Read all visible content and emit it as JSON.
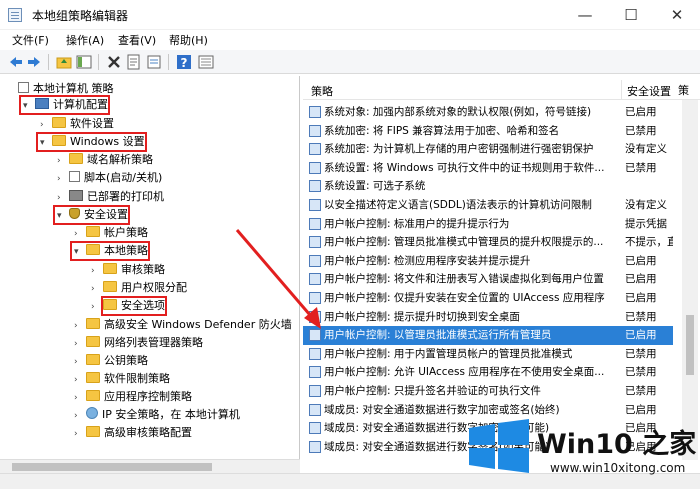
{
  "window": {
    "title": "本地组策略编辑器",
    "min": "—",
    "max": "☐",
    "close": "✕"
  },
  "menu": [
    "文件(F)",
    "操作(A)",
    "查看(V)",
    "帮助(H)"
  ],
  "toolbar_icons": [
    "back-icon",
    "forward-icon",
    "folder-up-icon",
    "show-hide-tree-icon",
    "delete-icon",
    "properties-icon",
    "export-icon",
    "help-icon",
    "view-icon"
  ],
  "tree": [
    {
      "label": "本地计算机 策略",
      "expanded": true,
      "icon": "doc",
      "highlighted": false
    },
    {
      "label": "计算机配置",
      "expanded": true,
      "icon": "pc",
      "highlighted": true
    },
    {
      "label": "软件设置",
      "expanded": false,
      "icon": "folder",
      "highlighted": false
    },
    {
      "label": "Windows 设置",
      "expanded": true,
      "icon": "folder",
      "highlighted": true
    },
    {
      "label": "域名解析策略",
      "expanded": false,
      "icon": "folder",
      "highlighted": false
    },
    {
      "label": "脚本(启动/关机)",
      "expanded": false,
      "icon": "doc",
      "highlighted": false
    },
    {
      "label": "已部署的打印机",
      "expanded": false,
      "icon": "printer",
      "highlighted": false
    },
    {
      "label": "安全设置",
      "expanded": true,
      "icon": "shield",
      "highlighted": true
    },
    {
      "label": "帐户策略",
      "expanded": false,
      "icon": "folder",
      "highlighted": false
    },
    {
      "label": "本地策略",
      "expanded": true,
      "icon": "folder",
      "highlighted": true
    },
    {
      "label": "审核策略",
      "expanded": false,
      "icon": "folder",
      "highlighted": false
    },
    {
      "label": "用户权限分配",
      "expanded": false,
      "icon": "folder",
      "highlighted": false
    },
    {
      "label": "安全选项",
      "expanded": false,
      "icon": "folder",
      "highlighted": true
    },
    {
      "label": "高级安全 Windows Defender 防火墙",
      "expanded": false,
      "icon": "folder",
      "highlighted": false
    },
    {
      "label": "网络列表管理器策略",
      "expanded": false,
      "icon": "folder",
      "highlighted": false
    },
    {
      "label": "公钥策略",
      "expanded": false,
      "icon": "folder",
      "highlighted": false
    },
    {
      "label": "软件限制策略",
      "expanded": false,
      "icon": "folder",
      "highlighted": false
    },
    {
      "label": "应用程序控制策略",
      "expanded": false,
      "icon": "folder",
      "highlighted": false
    },
    {
      "label": "IP 安全策略，在 本地计算机",
      "expanded": false,
      "icon": "net",
      "highlighted": false
    },
    {
      "label": "高级审核策略配置",
      "expanded": false,
      "icon": "folder",
      "highlighted": false
    }
  ],
  "list": {
    "col_policy": "策略",
    "col_setting": "安全设置",
    "rows": [
      {
        "name": "系统对象: 加强内部系统对象的默认权限(例如，符号链接)",
        "value": "已启用"
      },
      {
        "name": "系统加密: 将 FIPS 兼容算法用于加密、哈希和签名",
        "value": "已禁用"
      },
      {
        "name": "系统加密: 为计算机上存储的用户密钥强制进行强密钥保护",
        "value": "没有定义"
      },
      {
        "name": "系统设置: 将 Windows 可执行文件中的证书规则用于软件...",
        "value": "已禁用"
      },
      {
        "name": "系统设置: 可选子系统",
        "value": ""
      },
      {
        "name": "以安全描述符定义语言(SDDL)语法表示的计算机访问限制",
        "value": "没有定义"
      },
      {
        "name": "用户帐户控制: 标准用户的提升提示行为",
        "value": "提示凭据"
      },
      {
        "name": "用户帐户控制: 管理员批准模式中管理员的提升权限提示的...",
        "value": "不提示，直"
      },
      {
        "name": "用户帐户控制: 检测应用程序安装并提示提升",
        "value": "已启用"
      },
      {
        "name": "用户帐户控制: 将文件和注册表写入错误虚拟化到每用户位置",
        "value": "已启用"
      },
      {
        "name": "用户帐户控制: 仅提升安装在安全位置的 UIAccess 应用程序",
        "value": "已启用"
      },
      {
        "name": "用户帐户控制: 提示提升时切换到安全桌面",
        "value": "已禁用"
      },
      {
        "name": "用户帐户控制: 以管理员批准模式运行所有管理员",
        "value": "已启用"
      },
      {
        "name": "用户帐户控制: 用于内置管理员帐户的管理员批准模式",
        "value": "已禁用"
      },
      {
        "name": "用户帐户控制: 允许 UIAccess 应用程序在不使用安全桌面...",
        "value": "已禁用"
      },
      {
        "name": "用户帐户控制: 只提升签名并验证的可执行文件",
        "value": "已禁用"
      },
      {
        "name": "域成员: 对安全通道数据进行数字加密或签名(始终)",
        "value": "已启用"
      },
      {
        "name": "域成员: 对安全通道数据进行数字加密(如果可能)",
        "value": "已启用"
      },
      {
        "name": "域成员: 对安全通道数据进行数字签名(如果可能)",
        "value": "已启用"
      }
    ],
    "selected_index": 12
  },
  "right_edge_fragment": "策",
  "watermark": {
    "title": "Win10 之家",
    "url": "www.win10xitong.com"
  },
  "colors": {
    "highlight_box": "#e21f1f",
    "selection": "#2a80d6",
    "arrow": "#e21f1f",
    "win_logo": "#1e8ae3"
  }
}
